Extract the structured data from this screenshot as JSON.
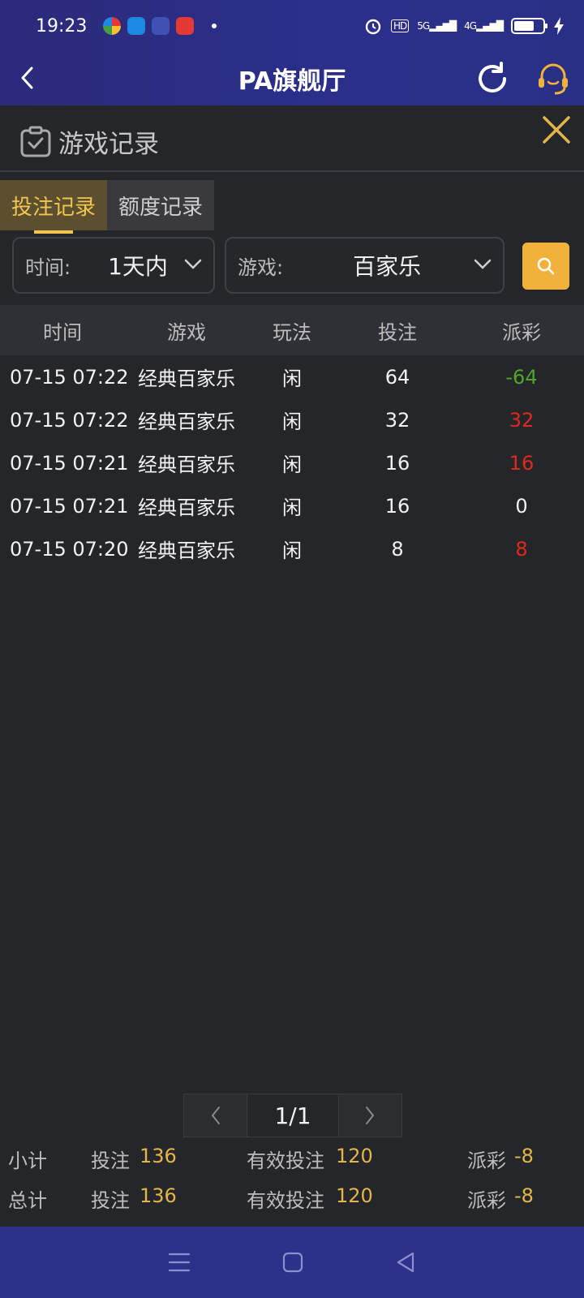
{
  "status": {
    "time": "19:23",
    "hd": "HD",
    "net1": "5G",
    "net2": "4G"
  },
  "header": {
    "title": "PA旗舰厅"
  },
  "panel": {
    "title": "游戏记录"
  },
  "tabs": [
    {
      "label": "投注记录",
      "active": true
    },
    {
      "label": "额度记录",
      "active": false
    }
  ],
  "filters": {
    "time_label": "时间:",
    "time_value": "1天内",
    "game_label": "游戏:",
    "game_value": "百家乐"
  },
  "table": {
    "headers": [
      "时间",
      "游戏",
      "玩法",
      "投注",
      "派彩"
    ],
    "rows": [
      {
        "time": "07-15 07:22",
        "game": "经典百家乐",
        "play": "闲",
        "bet": "64",
        "payout": "-64"
      },
      {
        "time": "07-15 07:22",
        "game": "经典百家乐",
        "play": "闲",
        "bet": "32",
        "payout": "32"
      },
      {
        "time": "07-15 07:21",
        "game": "经典百家乐",
        "play": "闲",
        "bet": "16",
        "payout": "16"
      },
      {
        "time": "07-15 07:21",
        "game": "经典百家乐",
        "play": "闲",
        "bet": "16",
        "payout": "0"
      },
      {
        "time": "07-15 07:20",
        "game": "经典百家乐",
        "play": "闲",
        "bet": "8",
        "payout": "8"
      }
    ]
  },
  "pager": {
    "page": "1/1"
  },
  "summary": [
    {
      "label": "小计",
      "bet_key": "投注",
      "bet": "136",
      "valid_key": "有效投注",
      "valid": "120",
      "payout_key": "派彩",
      "payout": "-8"
    },
    {
      "label": "总计",
      "bet_key": "投注",
      "bet": "136",
      "valid_key": "有效投注",
      "valid": "120",
      "payout_key": "派彩",
      "payout": "-8"
    }
  ],
  "colors": {
    "accent": "#f0b23a",
    "header_purple": "#2c2a7a",
    "payout_negative": "#4fa62a",
    "payout_positive": "#e0291e"
  }
}
